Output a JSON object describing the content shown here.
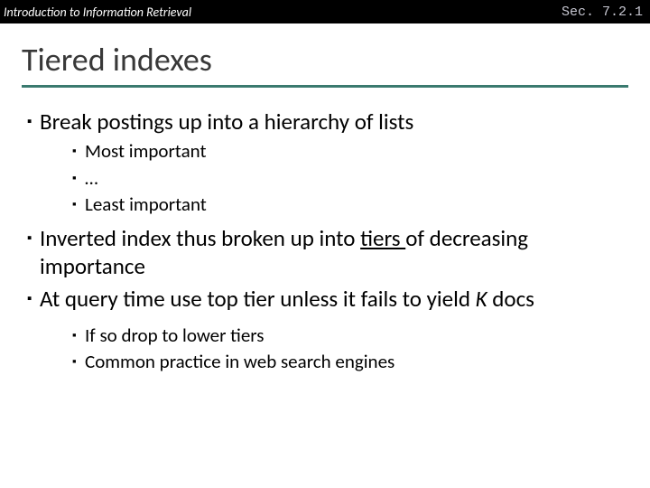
{
  "header": {
    "left": "Introduction to Information Retrieval",
    "right": "Sec. 7.2.1"
  },
  "title": "Tiered indexes",
  "b1": "Break postings up into a hierarchy of lists",
  "b1a": "Most important",
  "b1b": "…",
  "b1c": "Least important",
  "b2_pre": "Inverted index thus broken up into ",
  "b2_u": "tiers ",
  "b2_post": "of decreasing importance",
  "b3_pre": "At query time use top tier unless it fails to yield ",
  "b3_i": "K",
  "b3_post": " docs",
  "b3a": "If so drop to lower tiers",
  "b3b": "Common practice in web search engines"
}
